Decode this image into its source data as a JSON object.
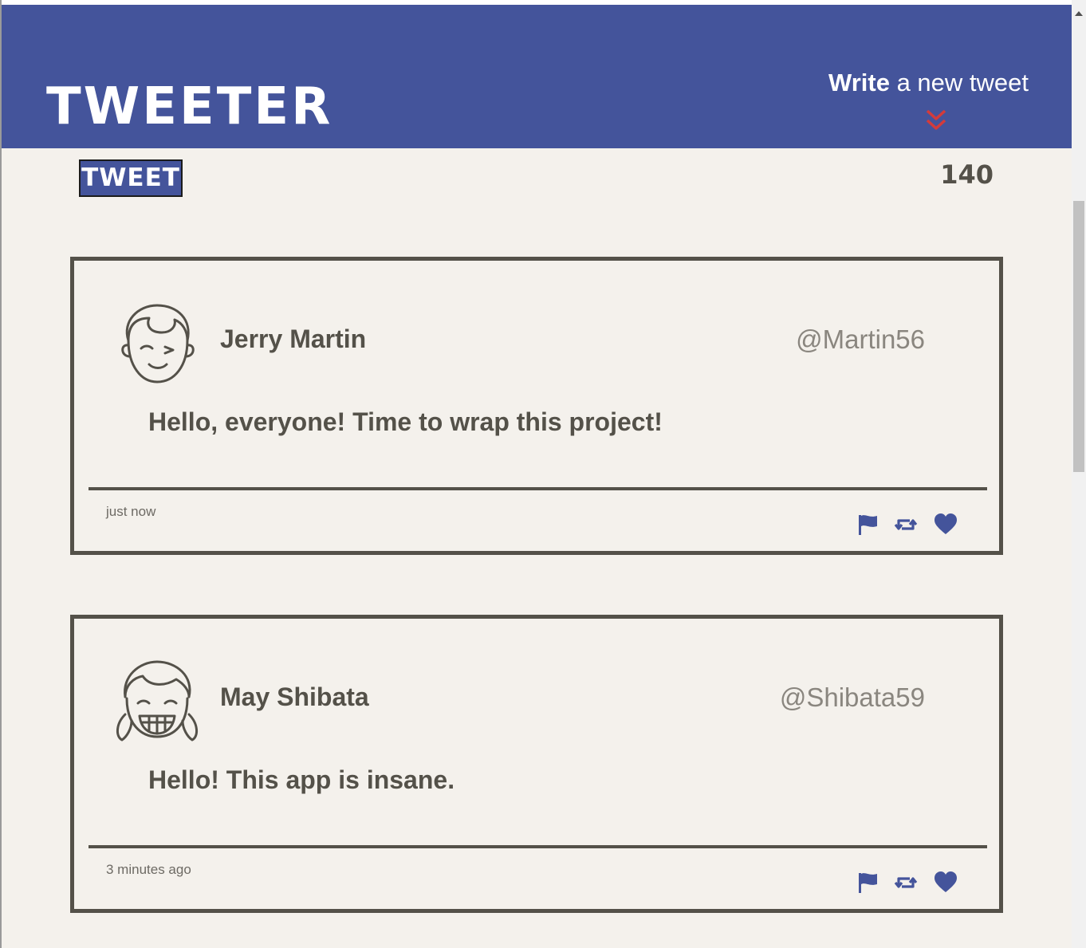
{
  "header": {
    "brand": "TWEETER",
    "compose_bold": "Write",
    "compose_rest": " a new tweet"
  },
  "composer": {
    "button_label": "TWEET",
    "counter": "140"
  },
  "tweets": [
    {
      "name": "Jerry Martin",
      "handle": "@Martin56",
      "content": "Hello, everyone! Time to wrap this project!",
      "timestamp": "just now",
      "avatar_icon": "boy-avatar-icon"
    },
    {
      "name": "May Shibata",
      "handle": "@Shibata59",
      "content": "Hello! This app is insane.",
      "timestamp": "3 minutes ago",
      "avatar_icon": "girl-avatar-icon"
    }
  ],
  "colors": {
    "nav_bg": "#44549b",
    "page_bg": "#f4f1ec",
    "text": "#545149",
    "accent_red": "#d33b3b",
    "icon_blue": "#44549b"
  }
}
